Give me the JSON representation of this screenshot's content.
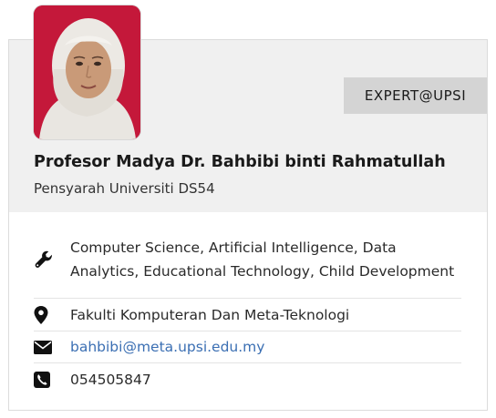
{
  "profile": {
    "name": "Profesor Madya Dr. Bahbibi binti Rahmatullah",
    "position": "Pensyarah Universiti DS54",
    "badge": "EXPERT@UPSI",
    "photo_alt": "Profile photo"
  },
  "info": {
    "expertise": "Computer Science, Artificial Intelligence, Data Analytics, Educational Technology, Child Development",
    "faculty": "Fakulti Komputeran Dan Meta-Teknologi",
    "email": "bahbibi@meta.upsi.edu.my",
    "phone": "054505847"
  },
  "icons": {
    "expertise": "wrench-icon",
    "faculty": "map-marker-icon",
    "email": "envelope-icon",
    "phone": "phone-icon"
  },
  "colors": {
    "photo_background": "#c4183a",
    "badge_background": "#d4d4d4",
    "header_background": "#f0f0f0",
    "link": "#3b6fb3"
  }
}
